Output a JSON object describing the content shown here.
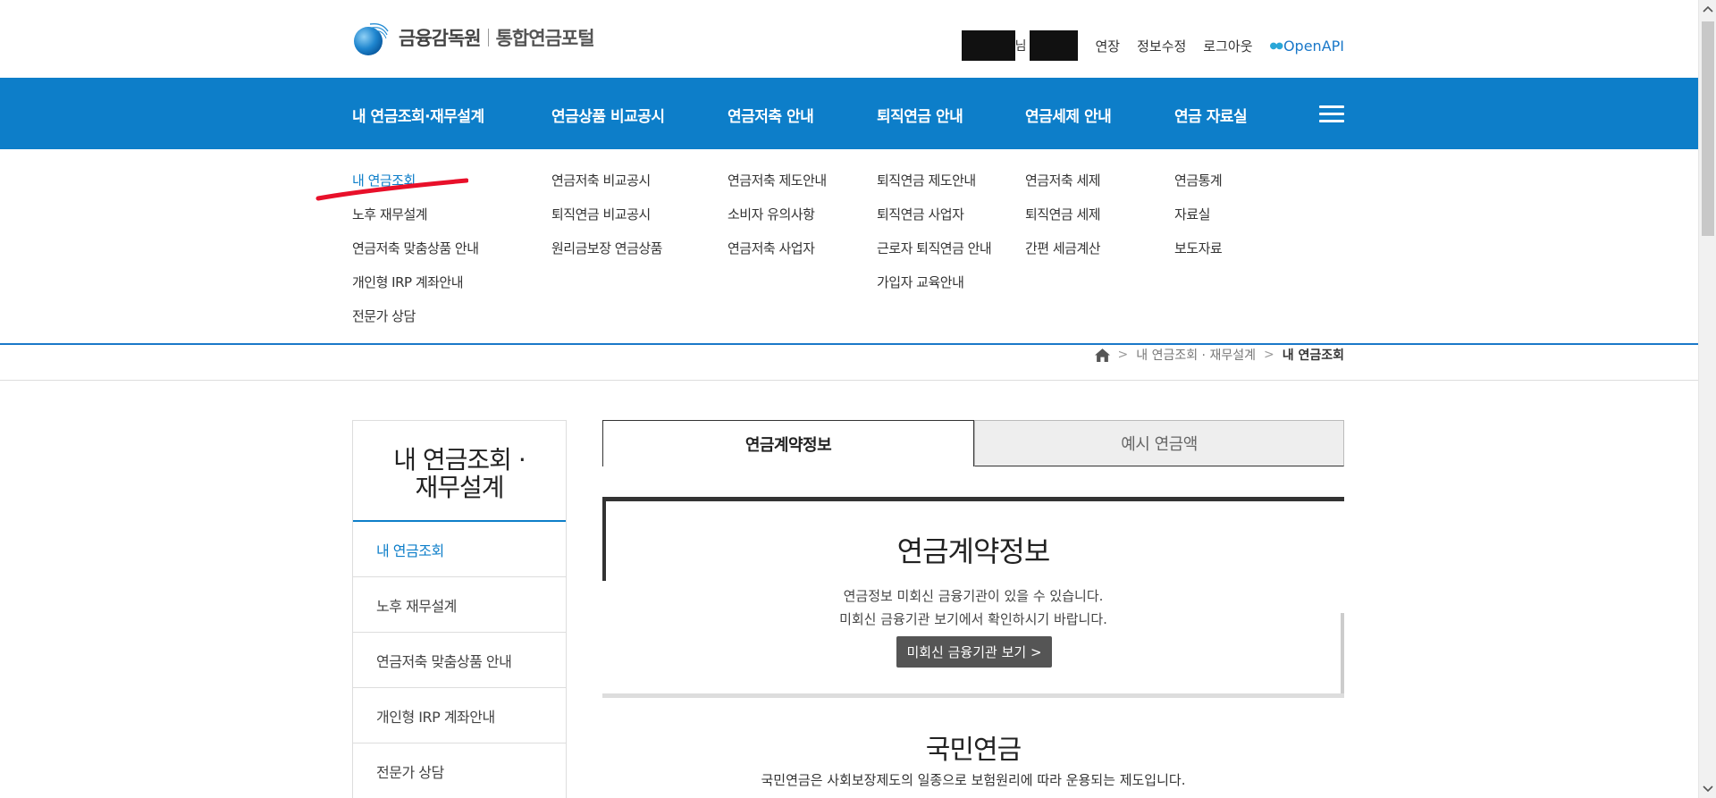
{
  "header": {
    "org_name": "금융감독원",
    "portal_name": "통합연금포털",
    "user_suffix": "님",
    "util_links": [
      "연장",
      "정보수정",
      "로그아웃"
    ],
    "openapi_label": "OpenAPI"
  },
  "gnb": {
    "items": [
      "내 연금조회·재무설계",
      "연금상품 비교공시",
      "연금저축 안내",
      "퇴직연금 안내",
      "연금세제 안내",
      "연금 자료실"
    ]
  },
  "mega_menu": {
    "col1": [
      "내 연금조회",
      "노후 재무설계",
      "연금저축 맞춤상품 안내",
      "개인형 IRP 계좌안내",
      "전문가 상담"
    ],
    "col2": [
      "연금저축 비교공시",
      "퇴직연금 비교공시",
      "원리금보장 연금상품"
    ],
    "col3": [
      "연금저축 제도안내",
      "소비자 유의사항",
      "연금저축 사업자"
    ],
    "col4": [
      "퇴직연금 제도안내",
      "퇴직연금 사업자",
      "근로자 퇴직연금 안내",
      "가입자 교육안내"
    ],
    "col5": [
      "연금저축 세제",
      "퇴직연금 세제",
      "간편 세금계산"
    ],
    "col6": [
      "연금통계",
      "자료실",
      "보도자료"
    ]
  },
  "breadcrumb": {
    "parent": "내 연금조회 · 재무설계",
    "current": "내 연금조회"
  },
  "lnb": {
    "title_line1": "내 연금조회 ·",
    "title_line2": "재무설계",
    "items": [
      "내 연금조회",
      "노후 재무설계",
      "연금저축 맞춤상품 안내",
      "개인형 IRP 계좌안내",
      "전문가 상담"
    ]
  },
  "tabs": {
    "active": "연금계약정보",
    "inactive": "예시 연금액"
  },
  "contract_box": {
    "title": "연금계약정보",
    "desc_line1": "연금정보 미회신 금융기관이 있을 수 있습니다.",
    "desc_line2": "미회신 금융기관 보기에서 확인하시기 바랍니다.",
    "button_label": "미회신 금융기관 보기 >"
  },
  "national_pension": {
    "title": "국민연금",
    "desc": "국민연금은 사회보장제도의 일종으로 보험원리에 따라 운용되는 제도입니다."
  },
  "colors": {
    "brand_blue": "#0d7ec9",
    "annotation_red": "#e8102a"
  }
}
